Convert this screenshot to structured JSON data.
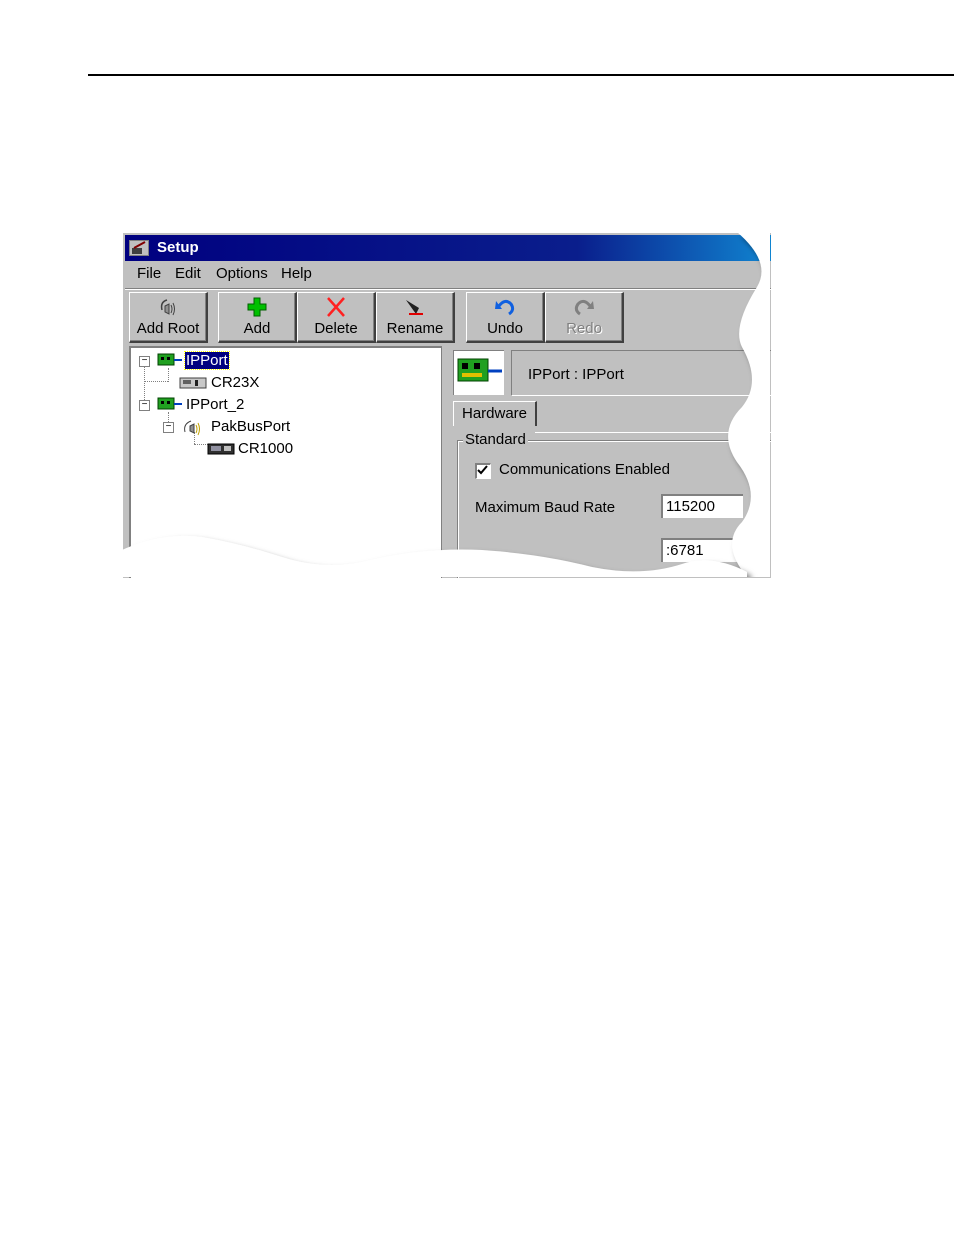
{
  "window": {
    "title": "Setup"
  },
  "menu": [
    "File",
    "Edit",
    "Options",
    "Help"
  ],
  "toolbar": [
    {
      "label": "Add Root",
      "icon": "add-root-icon",
      "enabled": true
    },
    {
      "label": "Add",
      "icon": "plus-icon",
      "enabled": true
    },
    {
      "label": "Delete",
      "icon": "delete-x-icon",
      "enabled": true
    },
    {
      "label": "Rename",
      "icon": "rename-icon",
      "enabled": true
    },
    {
      "label": "Undo",
      "icon": "undo-icon",
      "enabled": true
    },
    {
      "label": "Redo",
      "icon": "redo-icon",
      "enabled": false
    }
  ],
  "tree": [
    {
      "label": "IPPort",
      "icon": "ipport-icon",
      "selected": true,
      "level": 0
    },
    {
      "label": "CR23X",
      "icon": "datalogger-icon",
      "level": 1
    },
    {
      "label": "IPPort_2",
      "icon": "ipport-icon",
      "level": 0
    },
    {
      "label": "PakBusPort",
      "icon": "pakbus-icon",
      "level": 1
    },
    {
      "label": "CR1000",
      "icon": "datalogger-icon",
      "level": 2
    }
  ],
  "detail": {
    "header": "IPPort : IPPort",
    "tab": "Hardware",
    "group": "Standard",
    "comm_enabled_label": "Communications Enabled",
    "comm_enabled": true,
    "baud_label": "Maximum Baud Rate",
    "baud_value": "115200",
    "address_value": ":6781"
  }
}
